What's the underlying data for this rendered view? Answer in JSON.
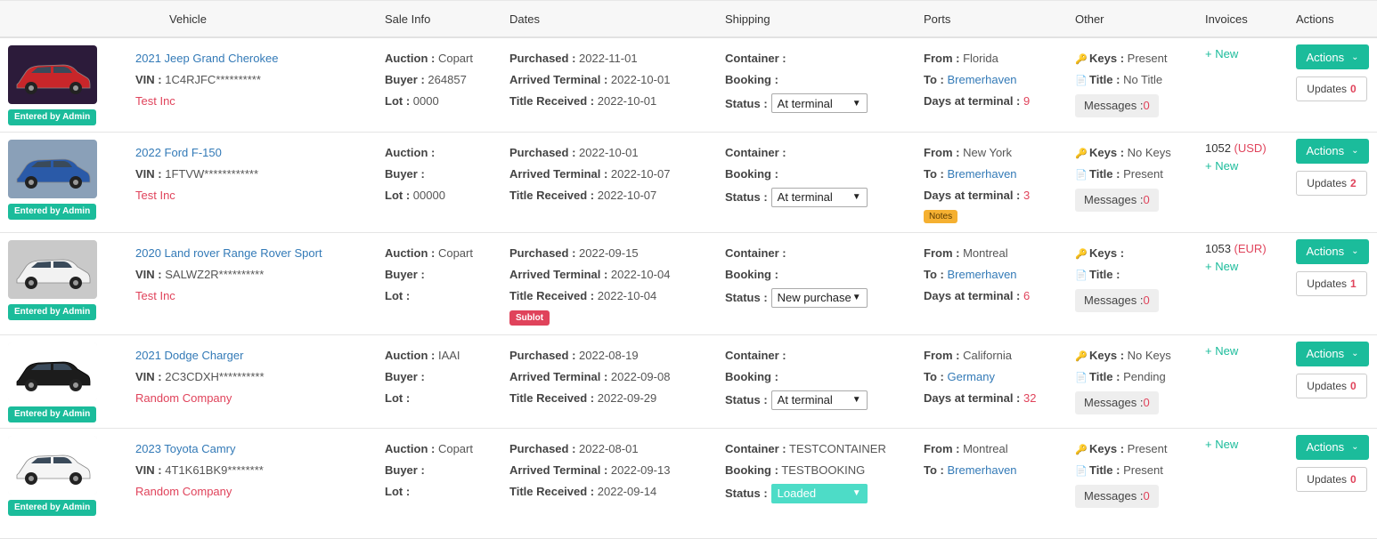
{
  "header": {
    "vehicle": "Vehicle",
    "sale_info": "Sale Info",
    "dates": "Dates",
    "shipping": "Shipping",
    "ports": "Ports",
    "other": "Other",
    "invoices": "Invoices",
    "actions": "Actions"
  },
  "labels": {
    "vin": "VIN :",
    "auction": "Auction :",
    "buyer": "Buyer :",
    "lot": "Lot :",
    "purchased": "Purchased :",
    "arrived": "Arrived Terminal :",
    "title_received": "Title Received :",
    "container": "Container :",
    "booking": "Booking :",
    "status": "Status :",
    "from": "From :",
    "to": "To :",
    "days": "Days at terminal :",
    "keys": "Keys :",
    "title": "Title :",
    "messages": "Messages :",
    "new": "+ New",
    "actions_btn": "Actions",
    "updates": "Updates",
    "entered_by": "Entered by Admin",
    "notes": "Notes",
    "sublot": "Sublot"
  },
  "rows": [
    {
      "name": "2021 Jeep Grand Cherokee",
      "vin": "1C4RJFC**********",
      "company": "Test Inc",
      "auction": "Copart",
      "buyer": "264857",
      "lot": "0000",
      "purchased": "2022-11-01",
      "arrived": "2022-10-01",
      "title_received": "2022-10-01",
      "container": "",
      "booking": "",
      "status": "At terminal",
      "from": "Florida",
      "to": "Bremerhaven",
      "days": "9",
      "keys": "Present",
      "title": "No Title",
      "messages": "0",
      "invoice": "",
      "invoice_currency": "",
      "updates": "0",
      "car_color": "#c8262a"
    },
    {
      "name": "2022 Ford F-150",
      "vin": "1FTVW************",
      "company": "Test Inc",
      "auction": "",
      "buyer": "",
      "lot": "00000",
      "purchased": "2022-10-01",
      "arrived": "2022-10-07",
      "title_received": "2022-10-07",
      "container": "",
      "booking": "",
      "status": "At terminal",
      "from": "New York",
      "to": "Bremerhaven",
      "days": "3",
      "keys": "No Keys",
      "title": "Present",
      "messages": "0",
      "invoice": "1052",
      "invoice_currency": "(USD)",
      "updates": "2",
      "car_color": "#2a5aa8"
    },
    {
      "name": "2020 Land rover Range Rover Sport",
      "vin": "SALWZ2R**********",
      "company": "Test Inc",
      "auction": "Copart",
      "buyer": "",
      "lot": "",
      "purchased": "2022-09-15",
      "arrived": "2022-10-04",
      "title_received": "2022-10-04",
      "container": "",
      "booking": "",
      "status": "New purchase",
      "from": "Montreal",
      "to": "Bremerhaven",
      "days": "6",
      "keys": "",
      "title": "",
      "messages": "0",
      "invoice": "1053",
      "invoice_currency": "(EUR)",
      "updates": "1",
      "car_color": "#f2f2f2"
    },
    {
      "name": "2021 Dodge Charger",
      "vin": "2C3CDXH**********",
      "company": "Random Company",
      "auction": "IAAI",
      "buyer": "",
      "lot": "",
      "purchased": "2022-08-19",
      "arrived": "2022-09-08",
      "title_received": "2022-09-29",
      "container": "",
      "booking": "",
      "status": "At terminal",
      "from": "California",
      "to": "Germany",
      "days": "32",
      "keys": "No Keys",
      "title": "Pending",
      "messages": "0",
      "invoice": "",
      "invoice_currency": "",
      "updates": "0",
      "car_color": "#1c1c1c"
    },
    {
      "name": "2023 Toyota Camry",
      "vin": "4T1K61BK9********",
      "company": "Random Company",
      "auction": "Copart",
      "buyer": "",
      "lot": "",
      "purchased": "2022-08-01",
      "arrived": "2022-09-13",
      "title_received": "2022-09-14",
      "container": "TESTCONTAINER",
      "booking": "TESTBOOKING",
      "status": "Loaded",
      "from": "Montreal",
      "to": "Bremerhaven",
      "days": "",
      "keys": "Present",
      "title": "Present",
      "messages": "0",
      "invoice": "",
      "invoice_currency": "",
      "updates": "0",
      "car_color": "#f5f5f5"
    }
  ]
}
